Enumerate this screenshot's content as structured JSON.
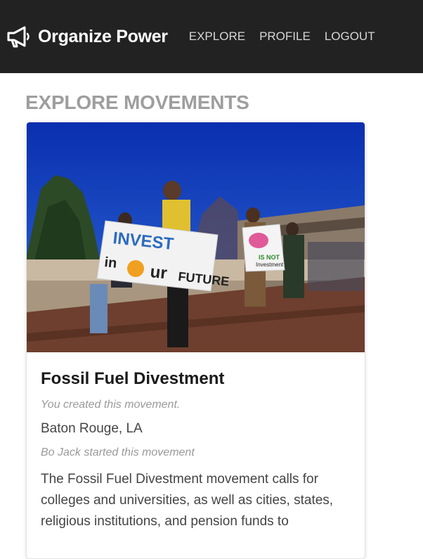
{
  "navbar": {
    "brand_icon": "megaphone-icon",
    "brand_name": "Organize Power",
    "links": [
      "EXPLORE",
      "PROFILE",
      "LOGOUT"
    ],
    "background": "#222222"
  },
  "page": {
    "heading": "EXPLORE MOVEMENTS"
  },
  "movements": [
    {
      "image_alt": "",
      "sign_texts": [
        "INVEST",
        "in",
        "OUR",
        "FUTURE",
        "IS NOT",
        "Investment"
      ],
      "title": "Fossil Fuel Divestment",
      "ownership_note": "You created this movement.",
      "location": "Baton Rouge, LA",
      "started_by": "Bo Jack started this movement",
      "description": "The Fossil Fuel Divestment movement calls for colleges and universities, as well as cities, states, religious institutions, and pension funds to"
    }
  ]
}
